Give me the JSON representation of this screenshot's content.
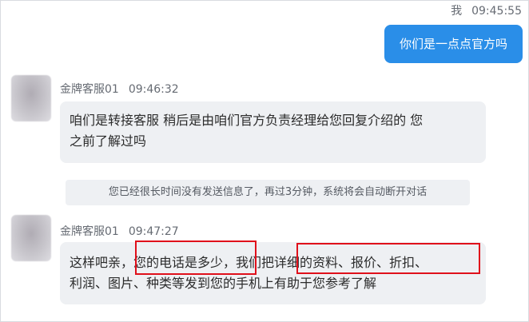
{
  "me": {
    "sender": "我",
    "time": "09:45:55",
    "message": "你们是一点点官方吗"
  },
  "agent_messages": [
    {
      "sender": "金牌客服01",
      "time": "09:46:32",
      "line1": "咱们是转接客服 稍后是由咱们官方负责经理给您回复介绍的 您",
      "line2": "之前了解过吗"
    },
    {
      "sender": "金牌客服01",
      "time": "09:47:27",
      "line1": "这样吧亲，您的电话是多少，我们把详细的资料、报价、折扣、",
      "line2": "利润、图片、种类等发到您的手机上有助于您参考了解"
    }
  ],
  "system_notice": "您已经很长时间没有发送信息了，再过3分钟，系统将会自动断开对话",
  "colors": {
    "my_bubble": "#2a8ee8",
    "agent_bubble": "#eef0f3",
    "highlight": "#e0101b"
  }
}
